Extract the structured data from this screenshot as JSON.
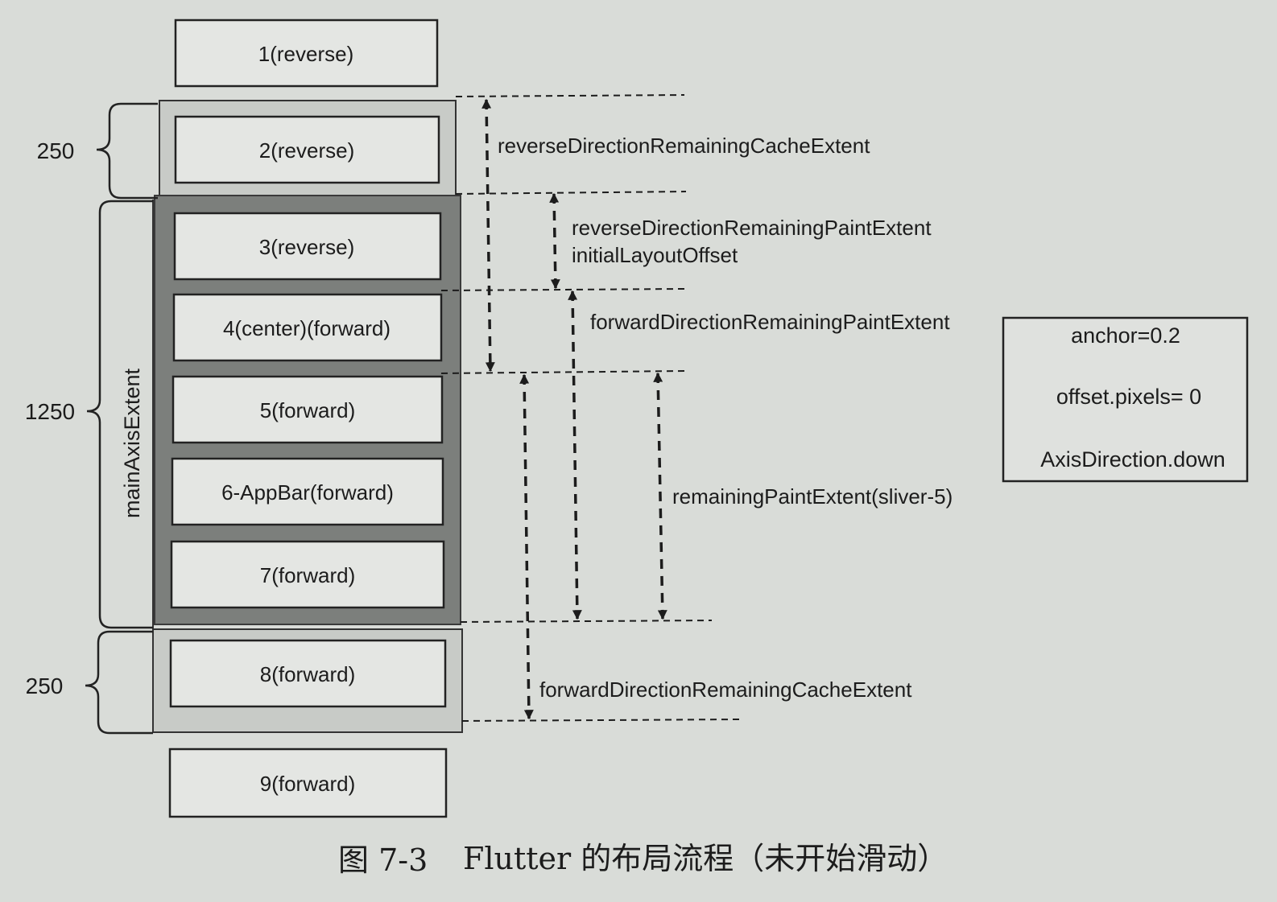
{
  "slivers": [
    {
      "label": "1(reverse)"
    },
    {
      "label": "2(reverse)"
    },
    {
      "label": "3(reverse)"
    },
    {
      "label": "4(center)(forward)"
    },
    {
      "label": "5(forward)"
    },
    {
      "label": "6-AppBar(forward)"
    },
    {
      "label": "7(forward)"
    },
    {
      "label": "8(forward)"
    },
    {
      "label": "9(forward)"
    }
  ],
  "extents": {
    "top_cache": "250",
    "viewport": "1250",
    "bottom_cache": "250",
    "main_axis_label": "mainAxisExtent"
  },
  "annotations": {
    "reverse_cache": "reverseDirectionRemainingCacheExtent",
    "reverse_paint": "reverseDirectionRemainingPaintExtent",
    "initial_offset": "initialLayoutOffset",
    "forward_paint": "forwardDirectionRemainingPaintExtent",
    "remaining_paint": "remainingPaintExtent(sliver-5)",
    "forward_cache": "forwardDirectionRemainingCacheExtent"
  },
  "info_box": {
    "anchor": "anchor=0.2",
    "offset": "offset.pixels= 0",
    "direction": "AxisDirection.down"
  },
  "caption": {
    "figure_no": "图 7-3",
    "title": "Flutter 的布局流程（未开始滑动）"
  }
}
